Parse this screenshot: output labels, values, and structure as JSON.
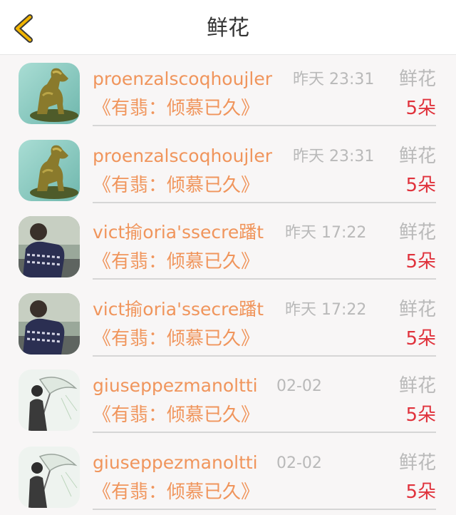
{
  "header": {
    "title": "鲜花",
    "back_icon": "chevron-left-icon",
    "accent": "#f1b400"
  },
  "items": [
    {
      "name": "proenzalscoqhoujler",
      "time": "昨天 23:31",
      "gift": "鲜花",
      "message": "《有翡：倾慕已久》",
      "count": "5朵",
      "avatar": "dog-statue"
    },
    {
      "name": "proenzalscoqhoujler",
      "time": "昨天 23:31",
      "gift": "鲜花",
      "message": "《有翡：倾慕已久》",
      "count": "5朵",
      "avatar": "dog-statue"
    },
    {
      "name": "vict揄oria'ssecre蹯t",
      "time": "昨天 17:22",
      "gift": "鲜花",
      "message": "《有翡：倾慕已久》",
      "count": "5朵",
      "avatar": "person-sweater"
    },
    {
      "name": "vict揄oria'ssecre蹯t",
      "time": "昨天 17:22",
      "gift": "鲜花",
      "message": "《有翡：倾慕已久》",
      "count": "5朵",
      "avatar": "person-sweater"
    },
    {
      "name": "giuseppezmanoltti",
      "time": "02-02",
      "gift": "鲜花",
      "message": "《有翡：倾慕已久》",
      "count": "5朵",
      "avatar": "umbrella-figure"
    },
    {
      "name": "giuseppezmanoltti",
      "time": "02-02",
      "gift": "鲜花",
      "message": "《有翡：倾慕已久》",
      "count": "5朵",
      "avatar": "umbrella-figure"
    }
  ]
}
